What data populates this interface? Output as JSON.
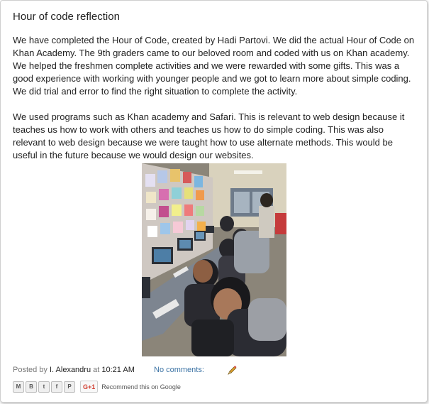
{
  "post": {
    "title": "Hour of code reflection",
    "paragraphs": [
      "We have completed the Hour of Code, created by Hadi Partovi. We did the actual Hour of Code on Khan Academy. The 9th graders came to our beloved room and coded with us on Khan academy. We helped the freshmen complete activities and we were rewarded with some gifts. This was a good experience with working with younger people and we got to learn more about simple coding. We did trial and error to find the right situation to complete the activity.",
      "We used programs such as Khan academy and Safari. This is relevant to web design because it teaches us how to work with others and teaches us how to do simple coding. This was also relevant to web design because we were taught how to use alternate methods. This would be useful in the future because we would design our websites."
    ]
  },
  "footer": {
    "posted_by_label": "Posted by",
    "author": "I. Alexandru",
    "at_label": "at",
    "time": "10:21 AM",
    "comments": "No comments:"
  },
  "share": {
    "buttons": [
      {
        "name": "email-share",
        "glyph": "M"
      },
      {
        "name": "blogthis-share",
        "glyph": "B"
      },
      {
        "name": "twitter-share",
        "glyph": "t"
      },
      {
        "name": "facebook-share",
        "glyph": "f"
      },
      {
        "name": "pinterest-share",
        "glyph": "P"
      }
    ],
    "gplus_label": "G+1",
    "recommend_text": "Recommend this on Google"
  },
  "colors": {
    "link": "#3d74a5",
    "meta": "#777777",
    "text": "#222222",
    "gplus": "#d23f31"
  }
}
